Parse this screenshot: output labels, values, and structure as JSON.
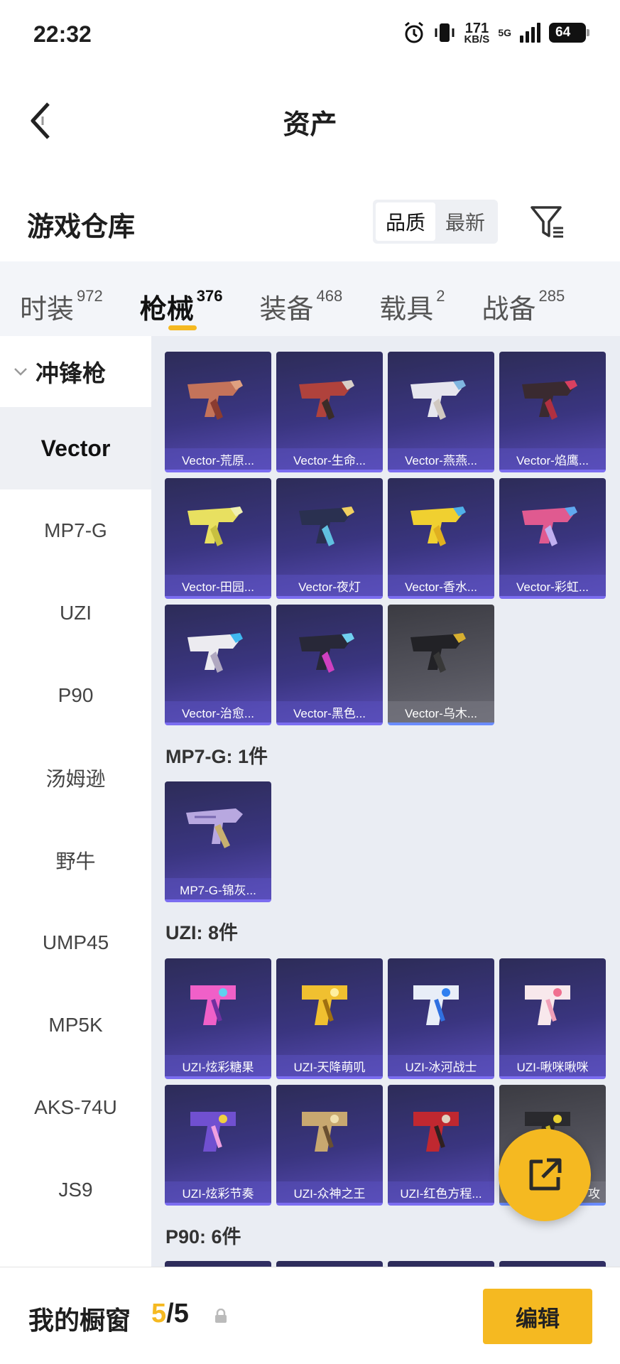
{
  "status": {
    "time": "22:32",
    "speed": "171",
    "speed_unit": "KB/S",
    "network": "5G",
    "battery": "64"
  },
  "header": {
    "title": "资产"
  },
  "warehouse": {
    "title": "游戏仓库",
    "sort_options": [
      "品质",
      "最新"
    ],
    "sort_active": "品质"
  },
  "categories": [
    {
      "label": "时装",
      "count": "972"
    },
    {
      "label": "枪械",
      "count": "376",
      "active": true
    },
    {
      "label": "装备",
      "count": "468"
    },
    {
      "label": "载具",
      "count": "2"
    },
    {
      "label": "战备",
      "count": "285"
    }
  ],
  "sidebar": {
    "group": "冲锋枪",
    "items": [
      "Vector",
      "MP7-G",
      "UZI",
      "P90",
      "汤姆逊",
      "野牛",
      "UMP45",
      "MP5K",
      "AKS-74U",
      "JS9"
    ],
    "active": "Vector"
  },
  "sections": {
    "mp7g_header": "MP7-G: 1件",
    "uzi_header": "UZI: 8件",
    "p90_header": "P90: 6件"
  },
  "cards": {
    "vector": [
      "Vector-荒原...",
      "Vector-生命...",
      "Vector-燕燕...",
      "Vector-焰鹰...",
      "Vector-田园...",
      "Vector-夜灯",
      "Vector-香水...",
      "Vector-彩虹...",
      "Vector-治愈...",
      "Vector-黑色...",
      "Vector-乌木..."
    ],
    "mp7g": [
      "MP7-G-锦灰..."
    ],
    "uzi": [
      "UZI-炫彩糖果",
      "UZI-天降萌叽",
      "UZI-冰河战士",
      "UZI-啾咪啾咪",
      "UZI-炫彩节奏",
      "UZI-众神之王",
      "UZI-红色方程...",
      "攻"
    ]
  },
  "bottom": {
    "label": "我的橱窗",
    "current": "5",
    "total": "/5",
    "edit": "编辑"
  },
  "colors": {
    "accent": "#f5b921",
    "card_bg": "#3a3580",
    "card_grey": "#55555e"
  }
}
